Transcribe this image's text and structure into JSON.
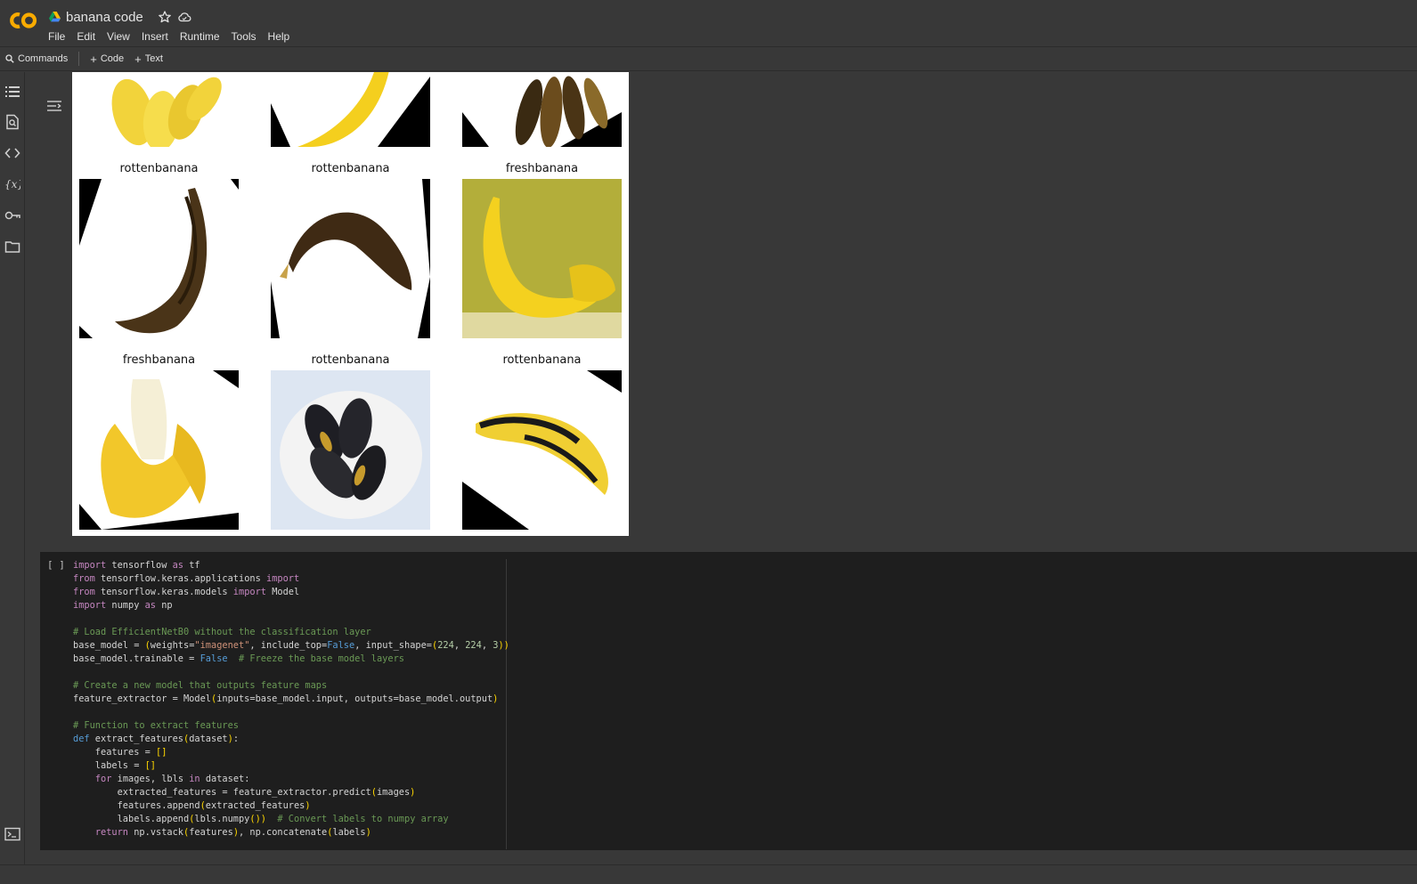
{
  "app": {
    "notebook_title": "banana code",
    "menu": [
      "File",
      "Edit",
      "View",
      "Insert",
      "Runtime",
      "Tools",
      "Help"
    ]
  },
  "toolbar": {
    "commands_label": "Commands",
    "add_code_label": "Code",
    "add_text_label": "Text"
  },
  "sidebar": {
    "icons": [
      "table-of-contents-icon",
      "find-icon",
      "code-snippets-icon",
      "variables-icon",
      "secrets-key-icon",
      "files-folder-icon"
    ]
  },
  "output": {
    "grid_labels": [
      "rottenbanana",
      "rottenbanana",
      "freshbanana",
      "freshbanana",
      "rottenbanana",
      "rottenbanana"
    ]
  },
  "cell": {
    "run_indicator": "[ ]",
    "code_lines": [
      "import tensorflow as tf",
      "from tensorflow.keras.applications import EfficientNetB0",
      "from tensorflow.keras.models import Model",
      "import numpy as np",
      "",
      "# Load EfficientNetB0 without the classification layer",
      "base_model = EfficientNetB0(weights=\"imagenet\", include_top=False, input_shape=(224, 224, 3))",
      "base_model.trainable = False  # Freeze the base model layers",
      "",
      "# Create a new model that outputs feature maps",
      "feature_extractor = Model(inputs=base_model.input, outputs=base_model.output)",
      "",
      "# Function to extract features",
      "def extract_features(dataset):",
      "    features = []",
      "    labels = []",
      "    for images, lbls in dataset:",
      "        extracted_features = feature_extractor.predict(images)",
      "        features.append(extracted_features)",
      "        labels.append(lbls.numpy())  # Convert labels to numpy array",
      "    return np.vstack(features), np.concatenate(labels)"
    ]
  },
  "colors": {
    "background": "#383838",
    "cell_background": "#1e1e1e",
    "logo_orange": "#f9ab00",
    "comment_green": "#6a9955",
    "keyword_purple": "#c586c0",
    "keyword_blue": "#569cd6",
    "string_orange": "#ce9178"
  }
}
